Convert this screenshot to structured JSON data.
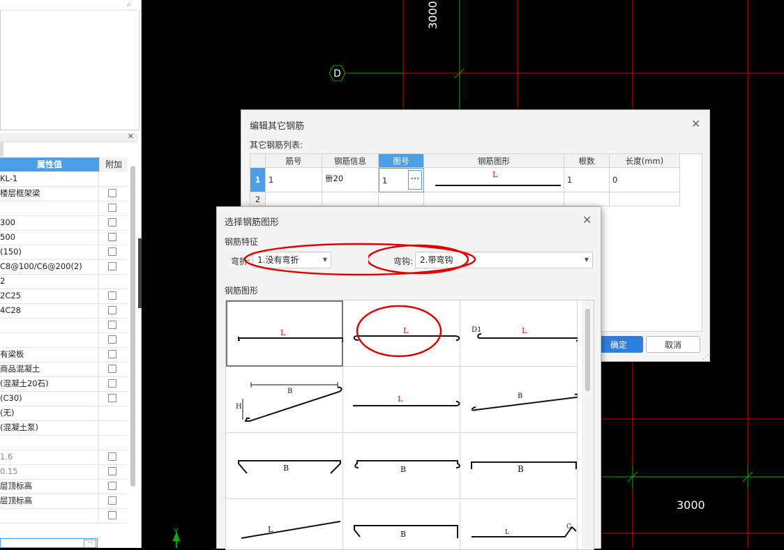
{
  "canvas": {
    "axis_label_d": "D",
    "dim_top": "3000",
    "dim_right": "3000",
    "ucs_y": "Y"
  },
  "left_panel": {
    "prop_header": "属性值",
    "fujia_header": "附加",
    "rows": [
      {
        "value": "KL-1",
        "checkbox": false
      },
      {
        "value": "楼层框架梁",
        "checkbox": true
      },
      {
        "value": "",
        "checkbox": true
      },
      {
        "value": "300",
        "checkbox": true
      },
      {
        "value": "500",
        "checkbox": true
      },
      {
        "value": "(150)",
        "checkbox": true
      },
      {
        "value": "C8@100/C6@200(2)",
        "checkbox": true
      },
      {
        "value": "2",
        "checkbox": false
      },
      {
        "value": "2C25",
        "checkbox": true
      },
      {
        "value": "4C28",
        "checkbox": true
      },
      {
        "value": "",
        "checkbox": true
      },
      {
        "value": "",
        "checkbox": true
      },
      {
        "value": "有梁板",
        "checkbox": true
      },
      {
        "value": "商品混凝土",
        "checkbox": true
      },
      {
        "value": "(混凝土20石)",
        "checkbox": true
      },
      {
        "value": "(C30)",
        "checkbox": true
      },
      {
        "value": "(无)",
        "checkbox": false
      },
      {
        "value": "(混凝土泵)",
        "checkbox": false
      },
      {
        "value": "",
        "checkbox": false
      },
      {
        "value": "1.6",
        "checkbox": true,
        "grey": true
      },
      {
        "value": "0.15",
        "checkbox": true,
        "grey": true
      },
      {
        "value": "层顶标高",
        "checkbox": true
      },
      {
        "value": "层顶标高",
        "checkbox": true
      },
      {
        "value": "",
        "checkbox": true
      }
    ],
    "bottom_edit_btn": "···"
  },
  "edit_dialog": {
    "title": "编辑其它钢筋",
    "list_label": "其它钢筋列表:",
    "columns": [
      "筋号",
      "钢筋信息",
      "图号",
      "钢筋图形",
      "根数",
      "长度(mm)"
    ],
    "rows": [
      {
        "num": "1",
        "jinhao": "1",
        "info": "卌20",
        "tuhao": "1",
        "shape_label": "L",
        "count": "1",
        "length": "0"
      },
      {
        "num": "2",
        "jinhao": "",
        "info": "",
        "tuhao": "",
        "shape_label": "",
        "count": "",
        "length": ""
      }
    ],
    "cell_btn": "···",
    "ok": "确定",
    "cancel": "取消"
  },
  "select_dialog": {
    "title": "选择钢筋图形",
    "feature_label": "钢筋特征",
    "bend_label": "弯折:",
    "bend_value": "1.没有弯折",
    "hook_label": "弯钩:",
    "hook_value": "2.带弯钩",
    "shape_label": "钢筋图形",
    "shape_texts": {
      "L": "L",
      "B": "B",
      "H": "H",
      "D1": "D1",
      "C": "C"
    }
  },
  "colors": {
    "grid_red": "#e00000",
    "grid_green": "#00b000",
    "accent_blue": "#2f7fe0",
    "annotation_red": "#e00000"
  }
}
